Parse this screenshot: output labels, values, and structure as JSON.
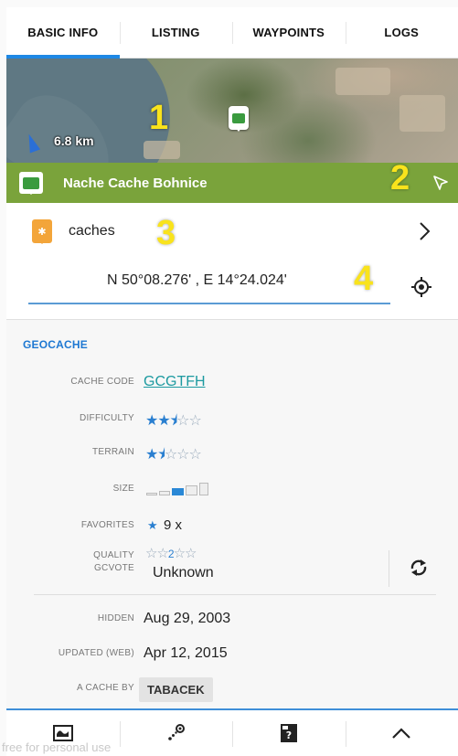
{
  "tabs": [
    {
      "label": "BASIC INFO",
      "active": true
    },
    {
      "label": "LISTING",
      "active": false
    },
    {
      "label": "WAYPOINTS",
      "active": false
    },
    {
      "label": "LOGS",
      "active": false
    }
  ],
  "map": {
    "distance": "6.8 km",
    "marker_number": "1"
  },
  "cache_header": {
    "name": "Nache Cache Bohnice",
    "marker_number": "2",
    "color": "#7aa33b"
  },
  "caches_row": {
    "label": "caches",
    "marker_number": "3"
  },
  "coords_row": {
    "coordinates": "N 50°08.276' , E 14°24.024'",
    "marker_number": "4"
  },
  "geocache": {
    "section_title": "GEOCACHE",
    "cache_code_label": "CACHE CODE",
    "cache_code": "GCGTFH",
    "difficulty_label": "DIFFICULTY",
    "difficulty_stars": 2.5,
    "terrain_label": "TERRAIN",
    "terrain_stars": 1.5,
    "size_label": "SIZE",
    "size_level": 3,
    "favorites_label": "FAVORITES",
    "favorites": "9 x",
    "quality_label": "QUALITY",
    "gcvote_label": "GCVOTE",
    "gcvote_value": "Unknown",
    "hidden_label": "HIDDEN",
    "hidden": "Aug 29, 2003",
    "updated_label": "UPDATED (WEB)",
    "updated": "Apr 12, 2015",
    "owner_label": "A CACHE BY",
    "owner": "TABACEK"
  },
  "watermark": "free for personal use",
  "icons": [
    "map-icon",
    "navigate-icon",
    "geocache-list-icon",
    "chevron-up-icon",
    "gps-target-icon",
    "refresh-icon",
    "chevron-right-icon",
    "share-icon"
  ],
  "accent_color": "#1e88e5"
}
